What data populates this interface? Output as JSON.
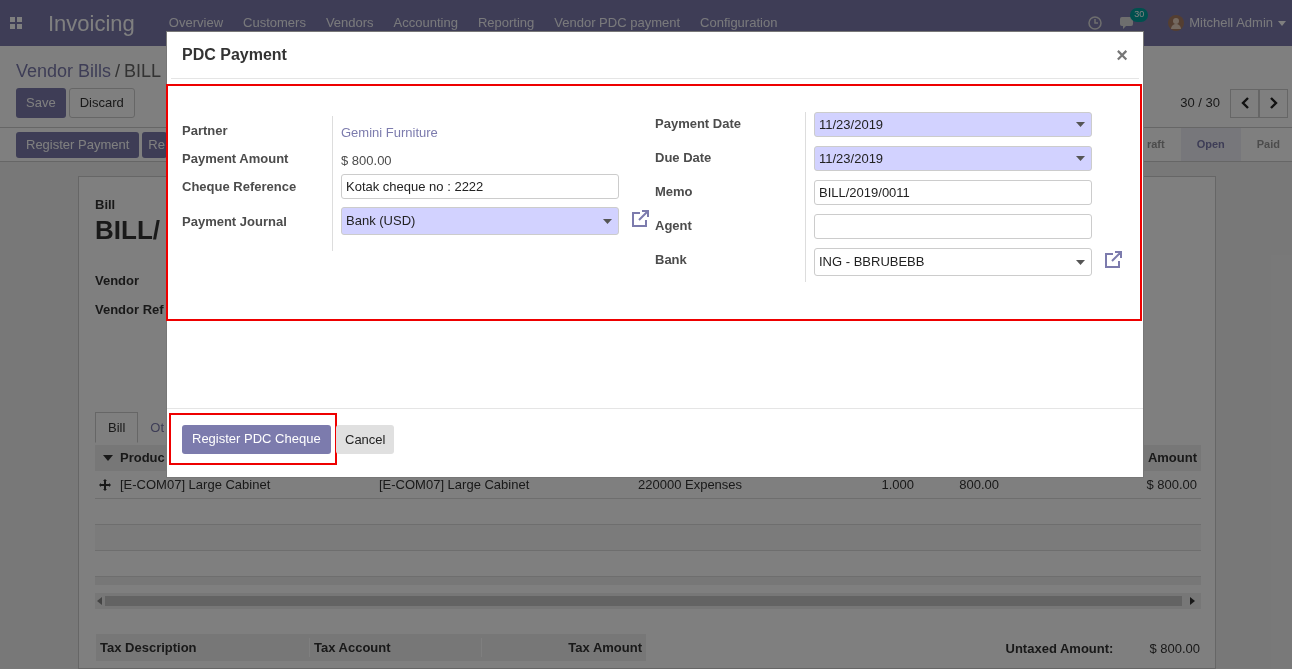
{
  "navbar": {
    "app_title": "Invoicing",
    "menu": [
      "Overview",
      "Customers",
      "Vendors",
      "Accounting",
      "Reporting",
      "Vendor PDC payment",
      "Configuration"
    ],
    "message_count": "30",
    "user": "Mitchell Admin"
  },
  "breadcrumb": {
    "parent": "Vendor Bills",
    "separator": "/",
    "current": "BILL"
  },
  "edit_buttons": [
    {
      "label": "Save",
      "kind": "primary"
    },
    {
      "label": "Discard",
      "kind": "secondary"
    }
  ],
  "pager": "30 / 30",
  "action_buttons": [
    "Register Payment",
    "Re"
  ],
  "statusbar": [
    {
      "label": "raft",
      "selected": false
    },
    {
      "label": "Open",
      "selected": true
    },
    {
      "label": "Paid",
      "selected": false
    }
  ],
  "sheet": {
    "type_label": "Bill",
    "title": "BILL/",
    "fields": [
      "Vendor",
      "Vendor Ref"
    ],
    "tabs": [
      {
        "label": "Bill",
        "selected": true
      },
      {
        "label": "Ot",
        "selected": false
      }
    ],
    "lines_table": {
      "columns": [
        "Produc",
        "",
        "",
        "",
        "",
        "Amount"
      ],
      "rows": [
        [
          "[E-COM07] Large Cabinet",
          "[E-COM07] Large Cabinet",
          "220000 Expenses",
          "1.000",
          "800.00",
          "$ 800.00"
        ]
      ]
    },
    "tax_table": {
      "columns": [
        "Tax Description",
        "Tax Account",
        "Tax Amount"
      ]
    },
    "totals": [
      {
        "label": "Untaxed Amount:",
        "value": "$ 800.00"
      }
    ]
  },
  "dialog": {
    "title": "PDC Payment",
    "close": "×",
    "left_fields": [
      {
        "label": "Partner",
        "kind": "link",
        "value": "Gemini Furniture"
      },
      {
        "label": "Payment Amount",
        "kind": "text",
        "value": "$ 800.00"
      },
      {
        "label": "Cheque Reference",
        "kind": "input",
        "value": "Kotak cheque no : 2222",
        "required": false
      },
      {
        "label": "Payment Journal",
        "kind": "select",
        "value": "Bank (USD)",
        "required": true,
        "external_link": true
      }
    ],
    "right_fields": [
      {
        "label": "Payment Date",
        "kind": "select",
        "value": "11/23/2019",
        "required": true,
        "external_link": false
      },
      {
        "label": "Due Date",
        "kind": "select",
        "value": "11/23/2019",
        "required": true,
        "external_link": false
      },
      {
        "label": "Memo",
        "kind": "input",
        "value": "BILL/2019/0011",
        "required": false
      },
      {
        "label": "Agent",
        "kind": "input",
        "required": false
      },
      {
        "label": "Bank",
        "kind": "select",
        "value": "ING - BBRUBEBB",
        "required": false,
        "external_link": true
      }
    ],
    "buttons": [
      {
        "label": "Register PDC Cheque",
        "kind": "primary"
      },
      {
        "label": "Cancel",
        "kind": "secondary"
      }
    ]
  }
}
